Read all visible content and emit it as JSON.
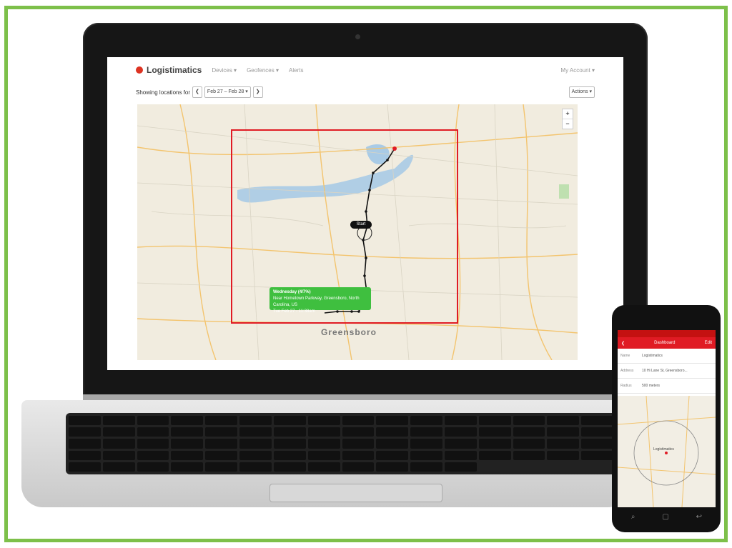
{
  "app": {
    "brand": "Logistimatics",
    "nav": [
      "Devices ▾",
      "Geofences ▾",
      "Alerts"
    ],
    "account": "My Account ▾"
  },
  "toolbar": {
    "label": "Showing locations for",
    "prev": "❮",
    "date_range": "Feb 27 – Feb 28 ▾",
    "next": "❯",
    "actions": "Actions ▾"
  },
  "map": {
    "city": "Greensboro",
    "zoom_in": "+",
    "zoom_out": "−",
    "marker": "Start",
    "tooltip": {
      "line1": "Wednesday (4/7%)",
      "line2": "Near Hometown Parkway, Greensboro, North Carolina, US",
      "line3": "Tue Feb 27 - 11:38am"
    }
  },
  "phone": {
    "title": "Dashboard",
    "back": "❮",
    "edit": "Edit",
    "rows": [
      {
        "key": "Name",
        "value": "Logistimatics"
      },
      {
        "key": "Address",
        "value": "10 Hi Lane St, Greensboro..."
      },
      {
        "key": "Radius",
        "value": "500 meters"
      }
    ],
    "map_label": "Logistimatics"
  },
  "colors": {
    "frame": "#7dc04a",
    "highlight": "#e01b24",
    "tooltip": "#3fbf3f",
    "brand_red": "#e01b24"
  }
}
